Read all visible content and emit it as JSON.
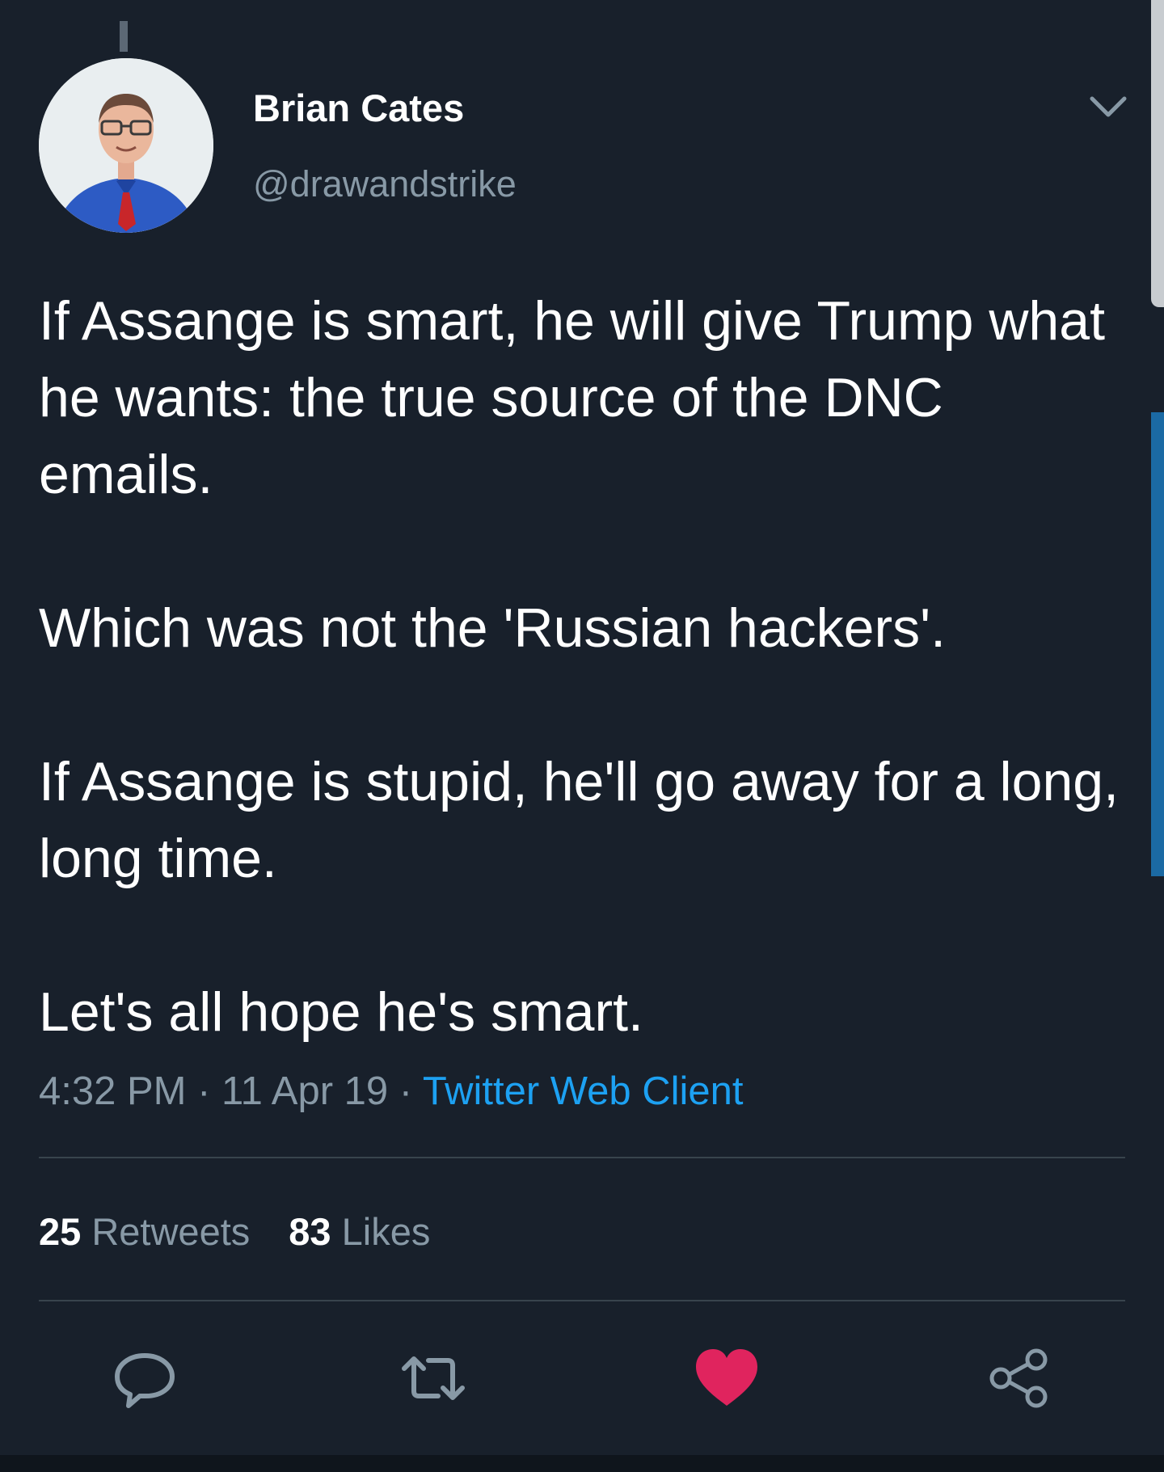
{
  "author": {
    "display_name": "Brian Cates",
    "handle": "@drawandstrike"
  },
  "tweet": {
    "paragraphs": [
      "If Assange is smart, he will give Trump what he wants: the true source of the DNC emails.",
      "Which was not the 'Russian hackers'.",
      "If Assange is stupid, he'll go away for a long, long time.",
      "Let's all hope he's smart."
    ],
    "time": "4:32 PM",
    "date": "11 Apr 19",
    "separator": " · ",
    "source": "Twitter Web Client"
  },
  "stats": {
    "retweets_count": "25",
    "retweets_label": "Retweets",
    "likes_count": "83",
    "likes_label": "Likes"
  },
  "actions": {
    "reply_icon": "reply-icon",
    "retweet_icon": "retweet-icon",
    "like_icon": "heart-icon",
    "share_icon": "share-icon",
    "liked": true
  },
  "colors": {
    "background": "#18202b",
    "secondary_text": "#8899a6",
    "link": "#1da1f2",
    "like_active": "#e0245e",
    "scroll_thumb": "#1b6aa4"
  }
}
